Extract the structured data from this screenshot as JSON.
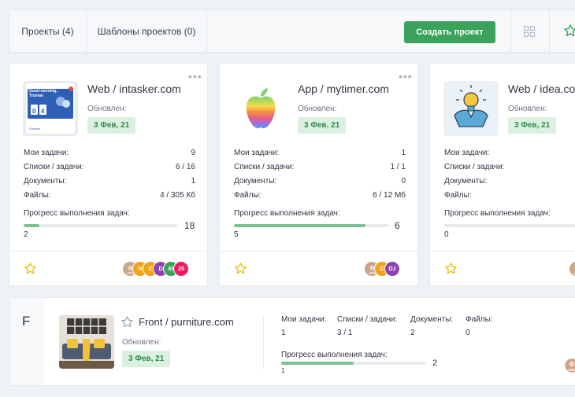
{
  "tabs": {
    "projects": "Проекты (4)",
    "templates": "Шаблоны проектов (0)"
  },
  "toolbar": {
    "create_label": "Создать проект"
  },
  "labels": {
    "updated": "Обновлен:",
    "my_tasks": "Мои задачи:",
    "lists_tasks": "Списки / задачи:",
    "documents": "Документы:",
    "files": "Файлы:",
    "progress": "Прогресс выполнения задач:"
  },
  "cards": [
    {
      "title": "Web / intasker.com",
      "date": "3 Фев, 21",
      "my_tasks": "9",
      "lists_tasks": "6 / 16",
      "documents": "1",
      "files": "4 / 305 Кб",
      "progress_fraction": 0.1,
      "progress_pct": "18",
      "done": "2",
      "thumb_text": [
        "Good morning,",
        "Truman",
        "0",
        "4",
        "Sunday"
      ],
      "avatars": [
        {
          "initials": "",
          "color": "#c9a58a"
        },
        {
          "initials": "N",
          "color": "#f0a31c"
        },
        {
          "initials": "C",
          "color": "#f0a31c"
        },
        {
          "initials": "D",
          "color": "#8e44ad"
        },
        {
          "initials": "EI",
          "color": "#3aa25a"
        },
        {
          "initials": "JS",
          "color": "#e91e63"
        }
      ]
    },
    {
      "title": "App / mytimer.com",
      "date": "3 Фев, 21",
      "my_tasks": "1",
      "lists_tasks": "1 / 1",
      "documents": "0",
      "files": "6 / 12 Мб",
      "progress_fraction": 0.85,
      "progress_pct": "6",
      "done": "5",
      "avatars": [
        {
          "initials": "",
          "color": "#c9a58a"
        },
        {
          "initials": "C",
          "color": "#f0a31c"
        },
        {
          "initials": "DJ",
          "color": "#8e44ad"
        }
      ]
    },
    {
      "title": "Web / idea.com",
      "date": "3 Фев, 21",
      "my_tasks": "",
      "lists_tasks": "",
      "documents": "",
      "files": "",
      "progress_fraction": 0,
      "progress_pct": "",
      "done": "0",
      "avatars": [
        {
          "initials": "",
          "color": "#c9a58a"
        }
      ]
    }
  ],
  "row": {
    "letter": "F",
    "title": "Front / purniture.com",
    "date": "3 Фев, 21",
    "my_tasks": "1",
    "lists_tasks": "3 / 1",
    "documents": "2",
    "files": "0",
    "progress_fraction": 0.5,
    "progress_pct": "2",
    "done": "1"
  },
  "colors": {
    "accent": "#3aa25a",
    "star": "#f2b705",
    "progress": "#7cc193"
  },
  "icons": [
    "grid-view-icon",
    "favorite-star-icon",
    "more-dots-icon"
  ]
}
